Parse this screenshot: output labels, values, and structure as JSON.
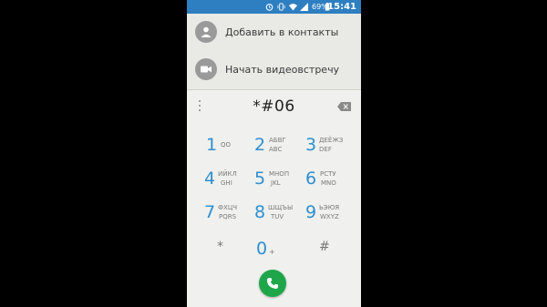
{
  "statusbar": {
    "battery_percent": "69%",
    "time": "15:41",
    "icons": [
      "alarm-icon",
      "vibrate-icon",
      "wifi-icon",
      "signal-icon",
      "battery-icon"
    ]
  },
  "actions": {
    "add_contact": "Добавить в контакты",
    "video_call": "Начать видеовстречу"
  },
  "dialpad": {
    "entered_digits": "*#06",
    "keys": [
      {
        "num": "1",
        "letters_ru": "",
        "letters_en": "QO"
      },
      {
        "num": "2",
        "letters_ru": "АБВГ",
        "letters_en": "ABC"
      },
      {
        "num": "3",
        "letters_ru": "ДЕЁЖЗ",
        "letters_en": "DEF"
      },
      {
        "num": "4",
        "letters_ru": "ИЙКЛ",
        "letters_en": "GHI"
      },
      {
        "num": "5",
        "letters_ru": "МНОП",
        "letters_en": "JKL"
      },
      {
        "num": "6",
        "letters_ru": "РСТУ",
        "letters_en": "MNO"
      },
      {
        "num": "7",
        "letters_ru": "ФХЦЧ",
        "letters_en": "PQRS"
      },
      {
        "num": "8",
        "letters_ru": "ШЩЪЫ",
        "letters_en": "TUV"
      },
      {
        "num": "9",
        "letters_ru": "ЬЭЮЯ",
        "letters_en": "WXYZ"
      },
      {
        "num": "*",
        "letters_ru": "",
        "letters_en": ""
      },
      {
        "num": "0",
        "letters_ru": "",
        "letters_en": "+"
      },
      {
        "num": "#",
        "letters_ru": "",
        "letters_en": ""
      }
    ]
  },
  "colors": {
    "statusbar": "#2e7fc1",
    "digit_blue": "#2f8fd0",
    "call_green": "#1fa64b"
  }
}
